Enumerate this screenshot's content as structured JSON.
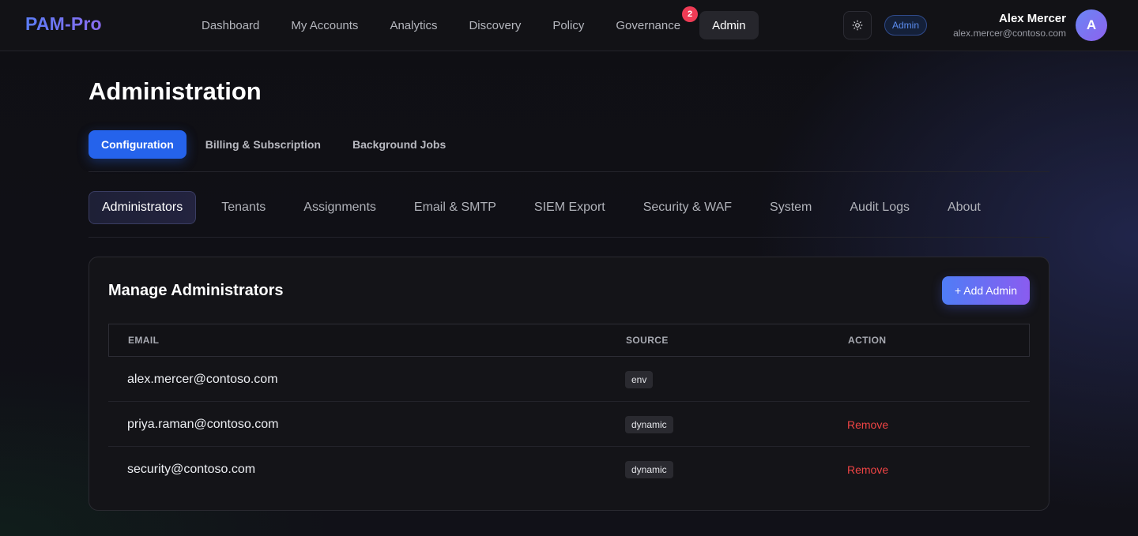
{
  "app": {
    "logo": "PAM-Pro"
  },
  "nav": {
    "items": [
      {
        "label": "Dashboard"
      },
      {
        "label": "My Accounts"
      },
      {
        "label": "Analytics"
      },
      {
        "label": "Discovery"
      },
      {
        "label": "Policy"
      },
      {
        "label": "Governance",
        "badge": "2"
      },
      {
        "label": "Admin",
        "active": true
      }
    ]
  },
  "header": {
    "theme_icon": "sun-icon",
    "role_badge": "Admin",
    "user_name": "Alex Mercer",
    "user_email": "alex.mercer@contoso.com",
    "avatar_initial": "A"
  },
  "page": {
    "title": "Administration"
  },
  "primary_tabs": [
    {
      "label": "Configuration",
      "active": true
    },
    {
      "label": "Billing & Subscription"
    },
    {
      "label": "Background Jobs"
    }
  ],
  "secondary_tabs": [
    {
      "label": "Administrators",
      "active": true
    },
    {
      "label": "Tenants"
    },
    {
      "label": "Assignments"
    },
    {
      "label": "Email & SMTP"
    },
    {
      "label": "SIEM Export"
    },
    {
      "label": "Security & WAF"
    },
    {
      "label": "System"
    },
    {
      "label": "Audit Logs"
    },
    {
      "label": "About"
    }
  ],
  "card": {
    "title": "Manage Administrators",
    "add_button": "+ Add Admin",
    "columns": {
      "email": "EMAIL",
      "source": "SOURCE",
      "action": "ACTION"
    },
    "rows": [
      {
        "email": "alex.mercer@contoso.com",
        "source": "env",
        "action": ""
      },
      {
        "email": "priya.raman@contoso.com",
        "source": "dynamic",
        "action": "Remove"
      },
      {
        "email": "security@contoso.com",
        "source": "dynamic",
        "action": "Remove"
      }
    ]
  },
  "colors": {
    "accent": "#2563eb",
    "danger": "#ef4444",
    "badge": "#ef3b55"
  }
}
